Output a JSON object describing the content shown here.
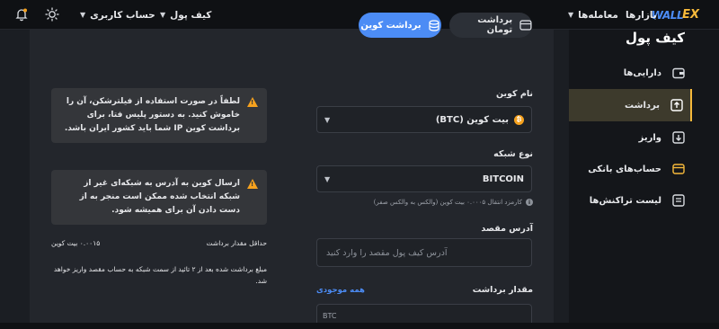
{
  "header": {
    "logo_text": "WALL",
    "logo_mark": "EX",
    "nav": [
      {
        "label": "بازارها",
        "has_caret": false
      },
      {
        "label": "معامله‌ها",
        "has_caret": true
      },
      {
        "label": "کیف پول",
        "has_caret": true
      },
      {
        "label": "حساب کاربری",
        "has_caret": true
      }
    ],
    "sun_icon": "sun-icon",
    "bell_icon": "bell-icon"
  },
  "sidebar": {
    "title": "کیف پول",
    "items": [
      {
        "label": "دارایی‌ها",
        "icon": "wallet-icon",
        "active": false
      },
      {
        "label": "برداشت",
        "icon": "upload-icon",
        "active": true
      },
      {
        "label": "واریز",
        "icon": "download-icon",
        "active": false
      },
      {
        "label": "حساب‌های بانکی",
        "icon": "card-icon",
        "active": false
      },
      {
        "label": "لیست تراکنش‌ها",
        "icon": "list-icon",
        "active": false
      }
    ]
  },
  "tabs": {
    "coin": "برداشت کوین",
    "toman": "برداشت تومان"
  },
  "form": {
    "coin_label": "نام کوین",
    "coin_value": "بیت کوین (BTC)",
    "network_label": "نوع شبکه",
    "network_value": "BITCOIN",
    "fee_note": "کارمزد انتقال ۰.۰۰۰۵ بیت کوین (والکس به والکس صفر)",
    "address_label": "آدرس مقصد",
    "address_placeholder": "آدرس کیف پول مقصد را وارد کنید",
    "amount_label": "مقدار برداشت",
    "all_link": "همه موجودی",
    "amount_unit": "BTC"
  },
  "warnings": [
    "لطفاً در صورت استفاده از فیلترشکن، آن را خاموش کنید. به دستور پلیس فتا، برای برداشت کوین IP شما باید کشور ایران باشد.",
    "ارسال کوین به آدرس به شبکه‌ای غیر از شبکه انتخاب شده ممکن است منجر به از دست دادن آن برای همیشه شود."
  ],
  "minimum": {
    "label": "حداقل مقدار برداشت",
    "value": "۰.۰۰۱۵ بیت کوین"
  },
  "note": "مبلغ برداشت شده بعد از ۲ تائید از سمت شبکه به حساب مقصد واریز خواهد شد.",
  "colors": {
    "accent": "#4c8cf5",
    "warning": "#f6a21e",
    "active_bg": "#3d3a2c"
  }
}
